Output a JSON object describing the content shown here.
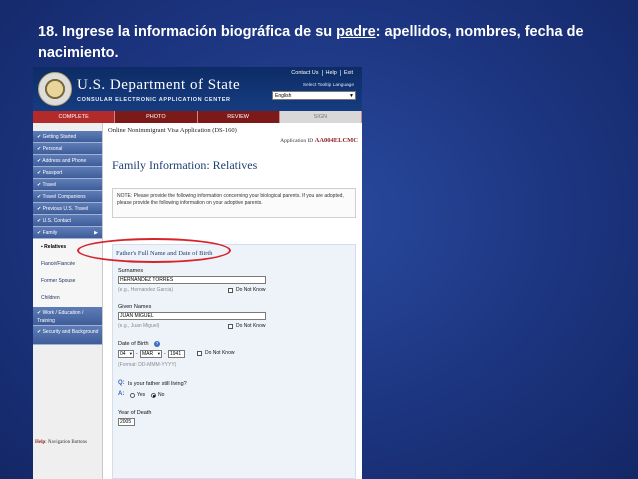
{
  "slide": {
    "title_part1": "18. Ingrese la información biográfica de su ",
    "title_underlined": "padre",
    "title_part2": ": apellidos, nombres, fecha de nacimiento."
  },
  "header": {
    "brand": "U.S. Department of State",
    "subtitle": "CONSULAR ELECTRONIC APPLICATION CENTER",
    "links": [
      "Contact Us",
      "Help",
      "Exit"
    ],
    "tooltip_label": "Select Tooltip Language",
    "language": "English"
  },
  "progress": {
    "steps": [
      "COMPLETE",
      "PHOTO",
      "REVIEW",
      "SIGN"
    ]
  },
  "nav": {
    "items": [
      "✔ Getting Started",
      "✔ Personal",
      "✔ Address and Phone",
      "✔ Passport",
      "✔ Travel",
      "✔ Travel Companions",
      "✔ Previous U.S. Travel",
      "✔ U.S. Contact",
      "✔ Family"
    ],
    "subitems": [
      "Relatives",
      "Fiancé/Fiancée",
      "Former Spouse",
      "Children"
    ],
    "items_after": [
      "✔ Work / Education / Training",
      "✔ Security and Background"
    ],
    "help_label": "Help",
    "help_text": ": Navigation Buttons"
  },
  "main": {
    "app_title": "Online Nonimmigrant Visa Application (DS-160)",
    "app_id_label": "Application ID",
    "app_id": "AA004ELCMC",
    "section_title": "Family Information: Relatives",
    "note": "NOTE: Please provide the following information concerning your biological parents. If you are adopted, please provide the following information on your adoptive parents."
  },
  "form": {
    "heading": "Father's Full Name and Date of Birth",
    "surnames_label": "Surnames",
    "surnames_value": "HERNANDEZ TORRES",
    "surnames_hint": "(e.g., Hernandez Garcia)",
    "given_label": "Given Names",
    "given_value": "JUAN MIGUEL",
    "given_hint": "(e.g., Juan Miguel)",
    "do_not_know": "Do Not Know",
    "dob_label": "Date of Birth",
    "dob_day": "04",
    "dob_month": "MAR",
    "dob_year": "1941",
    "dob_hint": "(Format: DD-MMM-YYYY)",
    "q_label": "Q:",
    "question": "Is your father still living?",
    "a_label": "A:",
    "yes": "Yes",
    "no": "No",
    "year_death_label": "Year of Death",
    "year_death_value": "2005"
  },
  "colors": {
    "slide_bg": "#1c3580",
    "header_bg": "#0d2c66",
    "progress_bg": "#7c1a1a",
    "nav_bg": "#4a68a5",
    "highlight": "#d9232b"
  }
}
